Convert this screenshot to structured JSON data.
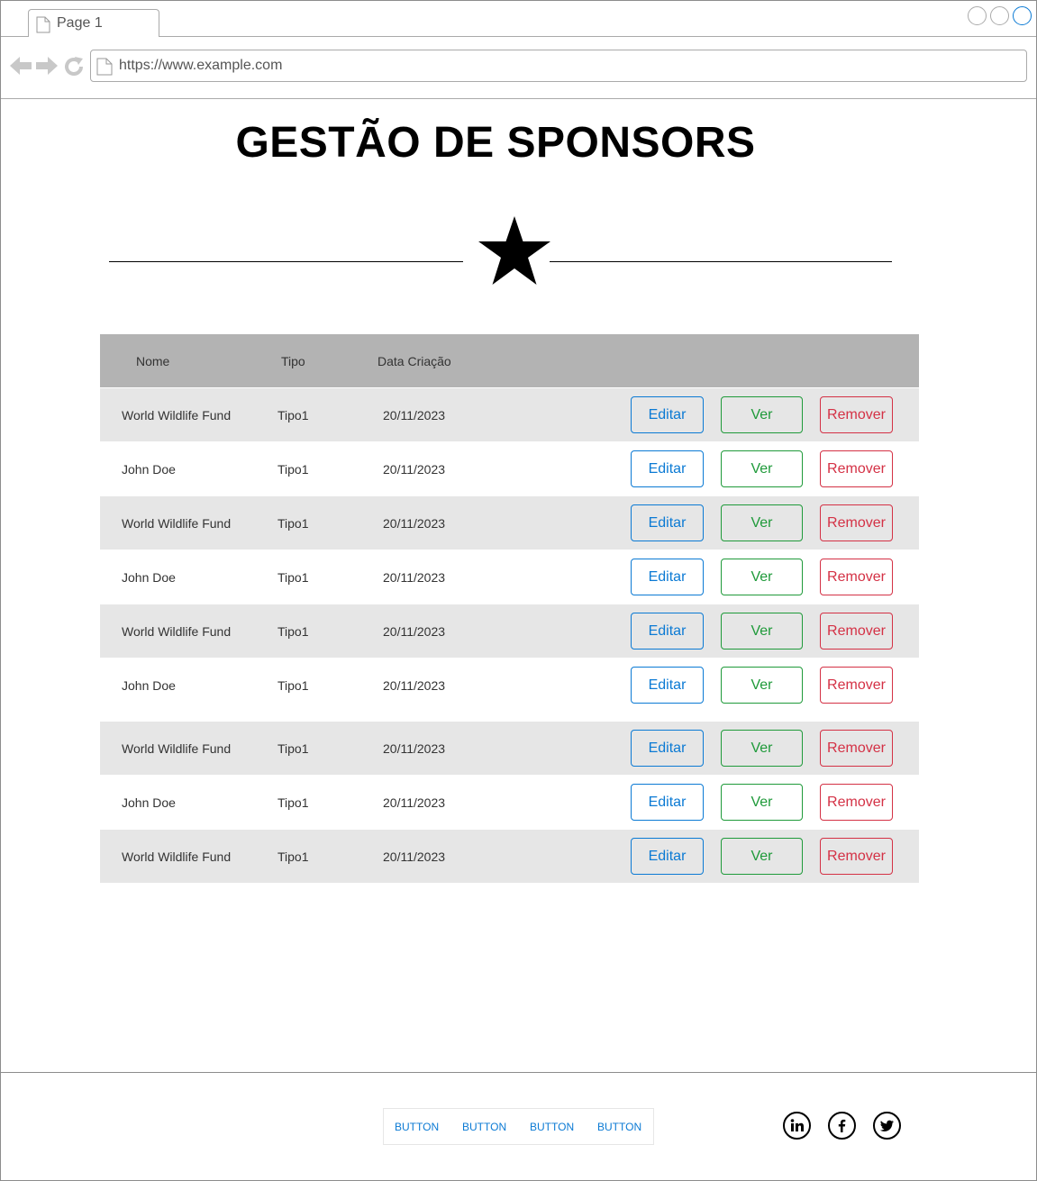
{
  "browser": {
    "tab_label": "Page 1",
    "url": "https://www.example.com"
  },
  "page": {
    "title": "GESTÃO DE SPONSORS"
  },
  "table": {
    "headers": {
      "nome": "Nome",
      "tipo": "Tipo",
      "data": "Data Criação"
    },
    "buttons": {
      "edit": "Editar",
      "view": "Ver",
      "remove": "Remover"
    },
    "rows": [
      {
        "nome": "World Wildlife Fund",
        "tipo": "Tipo1",
        "data": "20/11/2023"
      },
      {
        "nome": "John Doe",
        "tipo": "Tipo1",
        "data": "20/11/2023"
      },
      {
        "nome": "World Wildlife Fund",
        "tipo": "Tipo1",
        "data": "20/11/2023"
      },
      {
        "nome": "John Doe",
        "tipo": "Tipo1",
        "data": "20/11/2023"
      },
      {
        "nome": "World Wildlife Fund",
        "tipo": "Tipo1",
        "data": "20/11/2023"
      },
      {
        "nome": "John Doe",
        "tipo": "Tipo1",
        "data": "20/11/2023"
      },
      {
        "nome": "World Wildlife Fund",
        "tipo": "Tipo1",
        "data": "20/11/2023"
      },
      {
        "nome": "John Doe",
        "tipo": "Tipo1",
        "data": "20/11/2023"
      },
      {
        "nome": "World Wildlife Fund",
        "tipo": "Tipo1",
        "data": "20/11/2023"
      }
    ]
  },
  "footer": {
    "buttons": [
      "BUTTON",
      "BUTTON",
      "BUTTON",
      "BUTTON"
    ],
    "social_icons": [
      "linkedin-icon",
      "facebook-icon",
      "twitter-icon"
    ]
  },
  "colors": {
    "accent_blue": "#0b7ad4",
    "view_green": "#1f9a3a",
    "remove_red": "#d43145",
    "header_gray": "#b3b3b3",
    "row_shade": "#e6e6e6"
  }
}
